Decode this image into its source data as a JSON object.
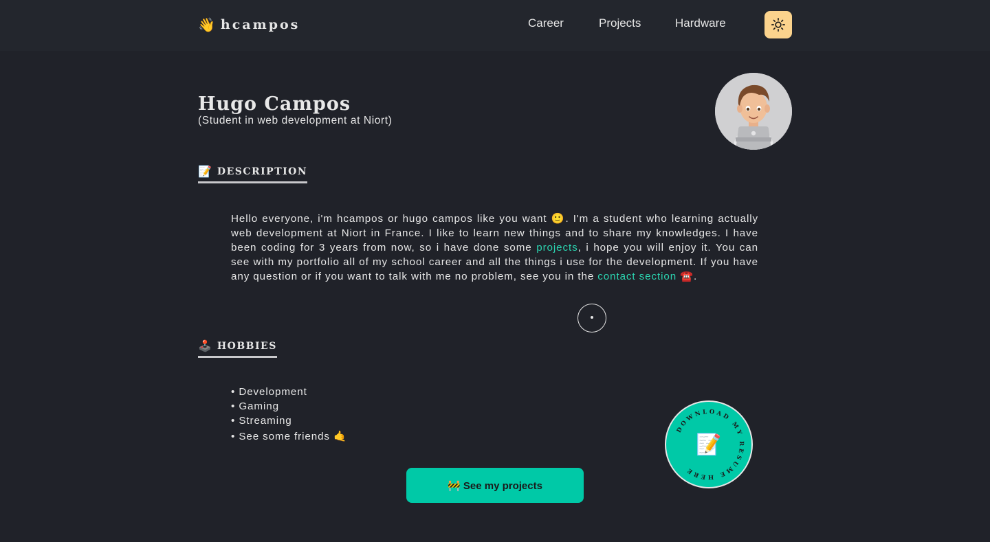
{
  "navbar": {
    "logo_emoji": "👋",
    "logo_text": "hcampos",
    "links": [
      {
        "label": "Career"
      },
      {
        "label": "Projects"
      },
      {
        "label": "Hardware"
      }
    ],
    "theme_toggle_icon": "sun-icon"
  },
  "header": {
    "name": "Hugo Campos",
    "role": "(Student in web development at Niort)"
  },
  "description": {
    "heading_emoji": "📝",
    "heading": "DESCRIPTION",
    "text_1": "Hello everyone, i'm hcampos or hugo campos like you want 🙂. I'm a student who learning actually web development at Niort in France. I like to learn new things and to share my knowledges. I have been coding for 3 years from now, so i have done some ",
    "link_projects": "projects",
    "text_2": ", i hope you will enjoy it. You can see with my portfolio all of my school career and all the things i use for the development. If you have any question or if you want to talk with me no problem, see you in the ",
    "link_contact": "contact section",
    "contact_emoji": " ☎️",
    "text_3": "."
  },
  "hobbies": {
    "heading_emoji": "🕹️",
    "heading": "HOBBIES",
    "items": [
      "• Development",
      "• Gaming",
      "• Streaming",
      "• See some friends 🤙"
    ]
  },
  "resume": {
    "circular_text": "DOWNLOAD MY RESUME HERE",
    "emoji": "📝"
  },
  "projects_button": {
    "label": "🚧 See my projects"
  },
  "colors": {
    "background": "#202229",
    "accent": "#00c9a7",
    "link": "#2bd4b0",
    "toggle": "#fbd38d"
  }
}
